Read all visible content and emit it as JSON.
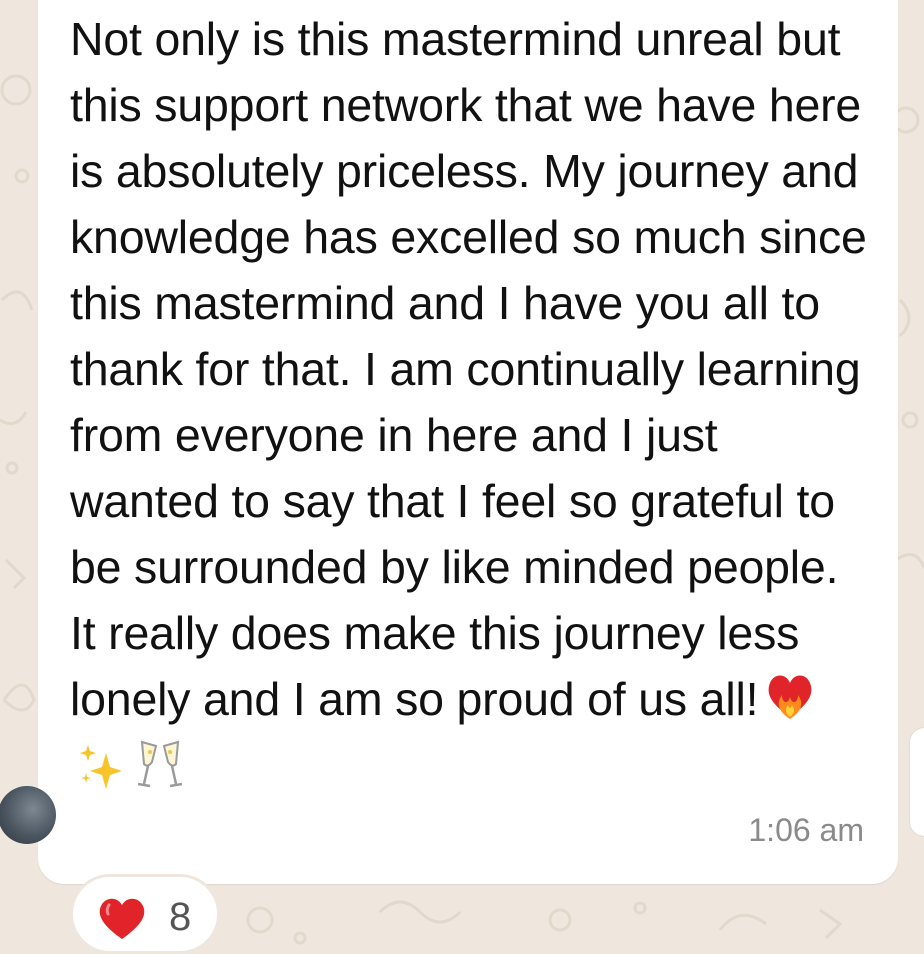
{
  "message": {
    "text": "Not only is this mastermind unreal but this support network that we have here is absolutely priceless. My journey and knowledge has excelled so much since this mastermind and I have you all to thank for that. I am continually learning from everyone in here and I just wanted to say that I feel so grateful to be surrounded by like minded people. It really does make this journey less lonely and I am so proud of us all!",
    "emojis": [
      "burning-heart-icon",
      "sparkles-icon",
      "clinking-glasses-icon"
    ],
    "timestamp": "1:06 am"
  },
  "reaction": {
    "icon": "red-heart-icon",
    "count": "8"
  },
  "colors": {
    "background": "#efe7dd",
    "bubble": "#ffffff",
    "text": "#111111",
    "timestamp": "#8a8a8a",
    "heart": "#e0242a"
  }
}
